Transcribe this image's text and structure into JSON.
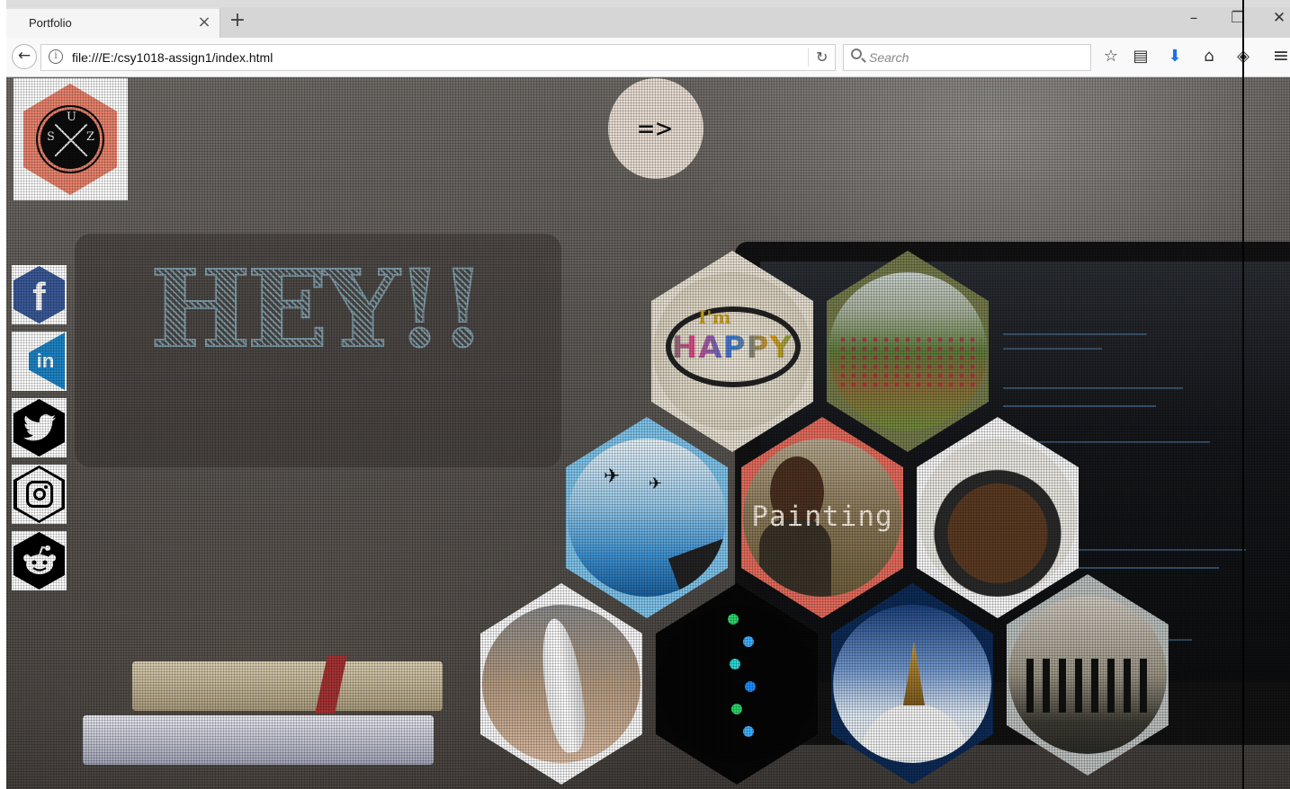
{
  "browser": {
    "tab_title": "Portfolio",
    "tab_close": "×",
    "new_tab": "+",
    "minimize": "–",
    "restore": "❐",
    "close": "✕",
    "back": "←",
    "info": "i",
    "url": "file:///E:/csy1018-assign1/index.html",
    "reload": "↻",
    "search_placeholder": "Search",
    "toolbar": {
      "bookmark": "☆",
      "reader": "▤",
      "download": "⬇",
      "home": "⌂",
      "pocket": "◈",
      "menu": "≡"
    }
  },
  "page": {
    "logo_letters": {
      "top": "U",
      "left": "S",
      "right": "Z"
    },
    "arrow_label": "=>",
    "hey_text": "HEY!!",
    "social": [
      {
        "name": "facebook",
        "glyph": "f",
        "color": "#3b5998"
      },
      {
        "name": "linkedin",
        "glyph": "in",
        "color": "#1c84c6"
      },
      {
        "name": "twitter",
        "glyph": "🐦",
        "color": "#000000"
      },
      {
        "name": "instagram",
        "glyph": "◎",
        "color": "#000000"
      },
      {
        "name": "reddit",
        "glyph": "◉",
        "color": "#000000"
      }
    ],
    "tiles": {
      "happy": {
        "im": "I'm",
        "word": "HAPPY"
      },
      "painting_label": "Painting"
    },
    "colors": {
      "logo_hex": "#e8826c",
      "arrow_button": "#e8ddd2",
      "hey_outline": "#7d9aa6"
    }
  }
}
